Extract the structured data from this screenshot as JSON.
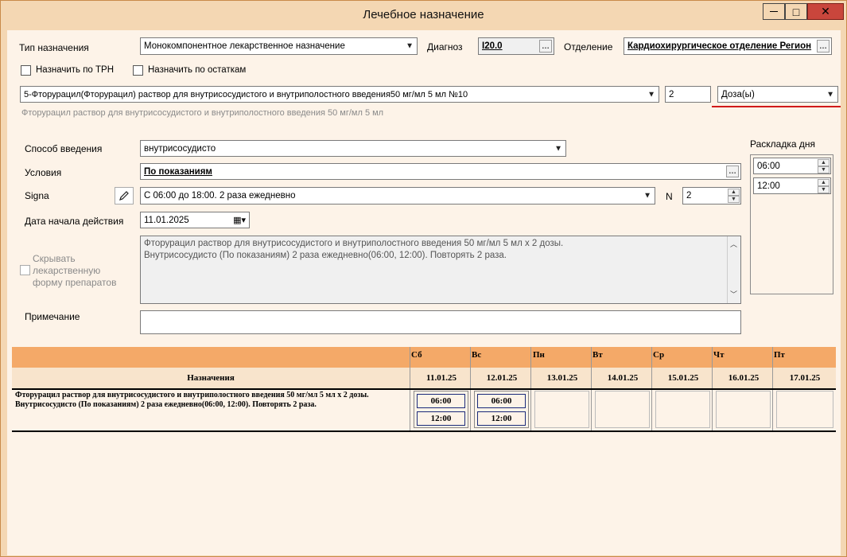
{
  "window": {
    "title": "Лечебное назначение",
    "minimize_glyph": "—",
    "maximize_glyph": "□",
    "close_glyph": "✕"
  },
  "form": {
    "type_label": "Тип назначения",
    "type_value": "Монокомпонентное лекарственное назначение",
    "diagnosis_label": "Диагноз",
    "diagnosis_value": "I20.0",
    "department_label": "Отделение",
    "department_value": "Кардиохирургическое отделение Регион",
    "assign_trn_label": "Назначить по ТРН",
    "assign_leftover_label": "Назначить по остаткам",
    "drug_value": "5-Фторурацил(Фторурацил) раствор для внутрисосудистого и внутриполостного введения50 мг/мл 5 мл №10",
    "dose_qty": "2",
    "dose_unit": "Доза(ы)",
    "drug_hint": "Фторурацил раствор для внутрисосудистого и внутриполостного введения 50 мг/мл 5 мл",
    "route_label": "Способ введения",
    "route_value": "внутрисосудисто",
    "conditions_label": "Условия",
    "conditions_value": "По показаниям",
    "signa_label": "Signa",
    "signa_value": "С 06:00 до 18:00. 2 раза ежедневно",
    "n_label": "N",
    "n_value": "2",
    "start_date_label": "Дата начала действия",
    "start_date_value": "11.01.2025",
    "hide_form_label_1": "Скрывать",
    "hide_form_label_2": "лекарственную",
    "hide_form_label_3": "форму препаратов",
    "summary_line1": "Фторурацил раствор для внутрисосудистого и внутриполостного введения 50 мг/мл 5 мл х 2 дозы.",
    "summary_line2": "Внутрисосудисто (По показаниям) 2 раза ежедневно(06:00, 12:00). Повторять 2 раза.",
    "note_label": "Примечание",
    "note_value": "",
    "day_layout_label": "Раскладка дня",
    "day_times": [
      "06:00",
      "12:00"
    ]
  },
  "grid": {
    "assignments_header": "Назначения",
    "days": [
      {
        "weekday": "Сб",
        "date": "11.01.25"
      },
      {
        "weekday": "Вс",
        "date": "12.01.25"
      },
      {
        "weekday": "Пн",
        "date": "13.01.25"
      },
      {
        "weekday": "Вт",
        "date": "14.01.25"
      },
      {
        "weekday": "Ср",
        "date": "15.01.25"
      },
      {
        "weekday": "Чт",
        "date": "16.01.25"
      },
      {
        "weekday": "Пт",
        "date": "17.01.25"
      }
    ],
    "row_line1": "Фторурацил раствор для внутрисосудистого и внутриполостного введения 50 мг/мл 5 мл х 2 дозы.",
    "row_line2": "Внутрисосудисто (По показаниям) 2 раза ежедневно(06:00, 12:00). Повторять 2 раза.",
    "row_times": [
      "06:00",
      "12:00"
    ]
  },
  "colors": {
    "accent_underline": "#d11a1a",
    "grid_header": "#f4a968",
    "window_frame": "#f4d7b3",
    "close_button": "#c9463c"
  }
}
